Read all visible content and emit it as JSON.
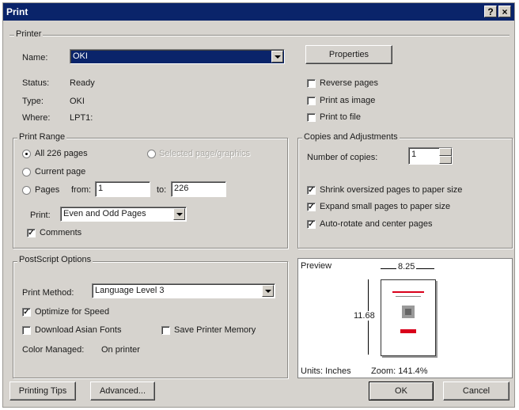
{
  "window": {
    "title": "Print",
    "help_btn": "?",
    "close_btn": "×"
  },
  "printer": {
    "group_label": "Printer",
    "name_label": "Name:",
    "name_value": "OKI",
    "properties_btn": "Properties",
    "status_label": "Status:",
    "status_value": "Ready",
    "type_label": "Type:",
    "type_value": "OKI",
    "where_label": "Where:",
    "where_value": "LPT1:",
    "reverse_pages": "Reverse pages",
    "print_as_image": "Print as image",
    "print_to_file": "Print to file"
  },
  "print_range": {
    "group_label": "Print Range",
    "all_pages": "All 226 pages",
    "selected": "Selected page/graphics",
    "current_page": "Current page",
    "pages": "Pages",
    "from_label": "from:",
    "from_value": "1",
    "to_label": "to:",
    "to_value": "226",
    "print_label": "Print:",
    "print_value": "Even and Odd Pages",
    "comments": "Comments"
  },
  "copies": {
    "group_label": "Copies and Adjustments",
    "number_label": "Number of copies:",
    "number_value": "1",
    "shrink": "Shrink oversized pages to paper size",
    "expand": "Expand small pages to paper size",
    "autorotate": "Auto-rotate and center pages"
  },
  "postscript": {
    "group_label": "PostScript Options",
    "method_label": "Print Method:",
    "method_value": "Language Level 3",
    "optimize": "Optimize for Speed",
    "download_fonts": "Download Asian Fonts",
    "save_memory": "Save Printer Memory",
    "color_managed_label": "Color Managed:",
    "color_managed_value": "On printer"
  },
  "preview": {
    "label": "Preview",
    "width": "8.25",
    "height": "11.68",
    "units": "Units: Inches",
    "zoom": "Zoom: 141.4%"
  },
  "footer": {
    "printing_tips": "Printing Tips",
    "advanced": "Advanced...",
    "ok": "OK",
    "cancel": "Cancel"
  },
  "colors": {
    "title_bar": "#0a246a",
    "dialog_bg": "#d6d3ce",
    "red_accent": "#d9001b"
  }
}
